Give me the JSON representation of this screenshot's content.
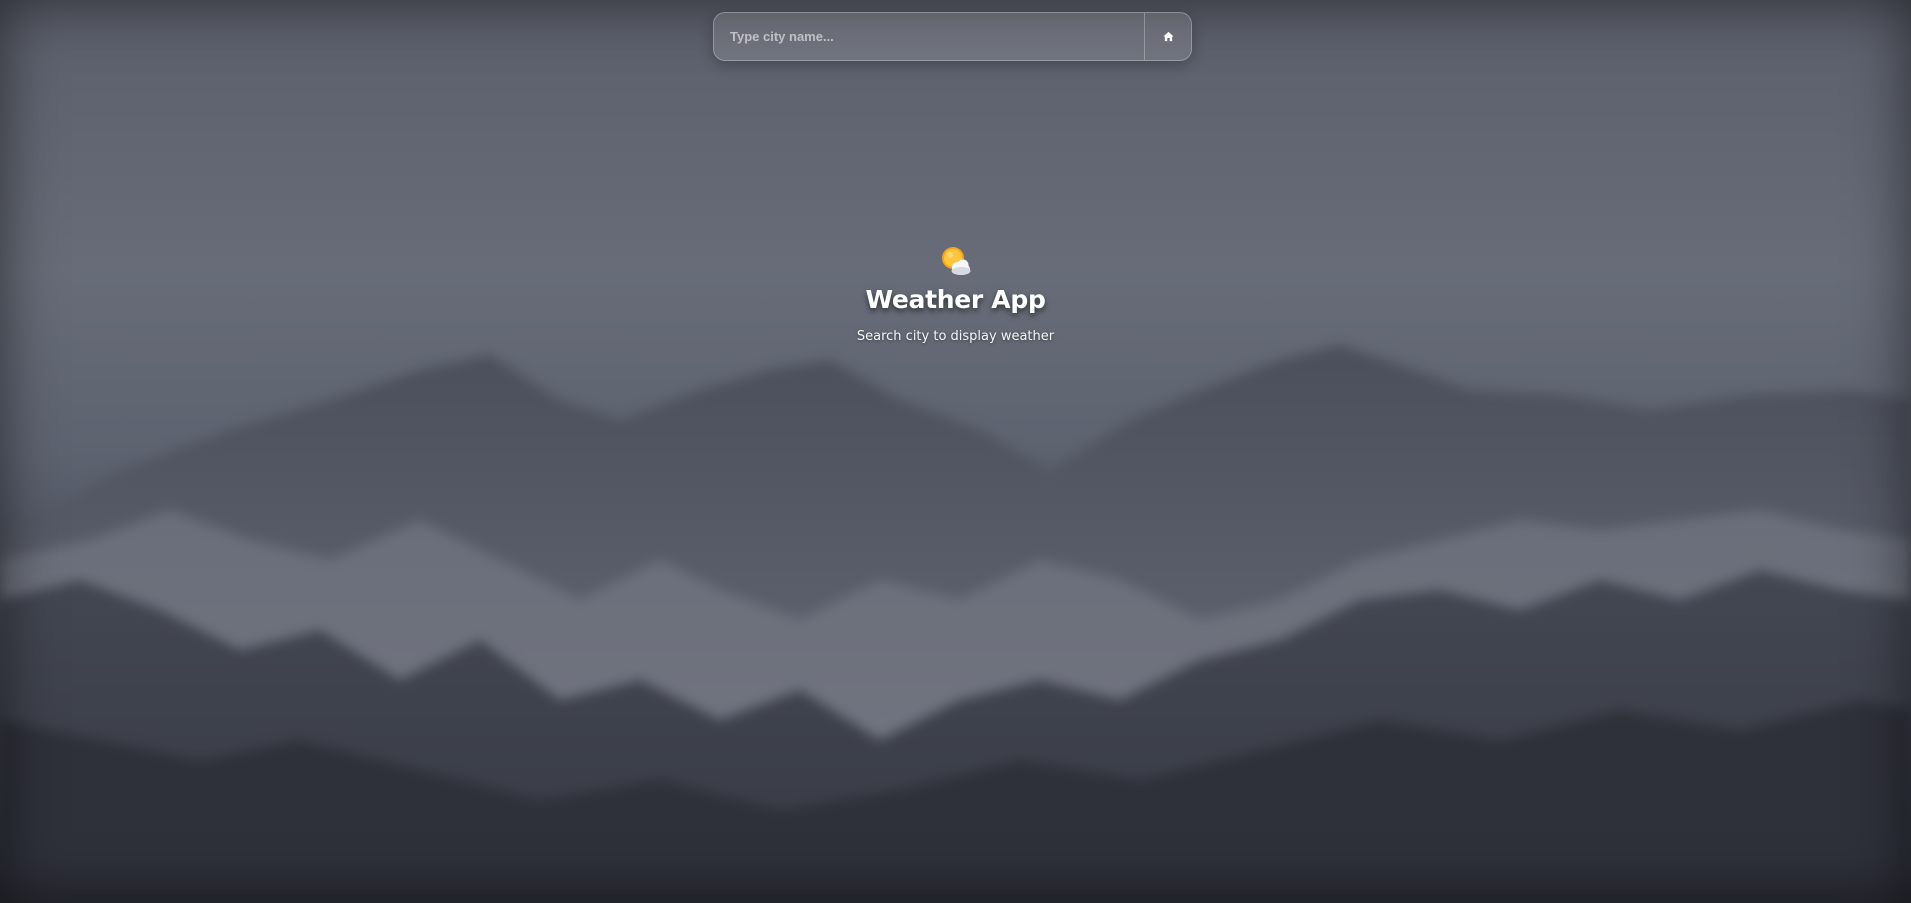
{
  "search": {
    "placeholder": "Type city name...",
    "value": "",
    "home_icon": "home-icon"
  },
  "welcome": {
    "icon": "sun-behind-cloud-icon",
    "title": "Weather App",
    "subtitle": "Search city to display weather"
  },
  "colors": {
    "background_top": "#676c78",
    "background_bottom": "#2f323c",
    "text": "#ffffff"
  }
}
